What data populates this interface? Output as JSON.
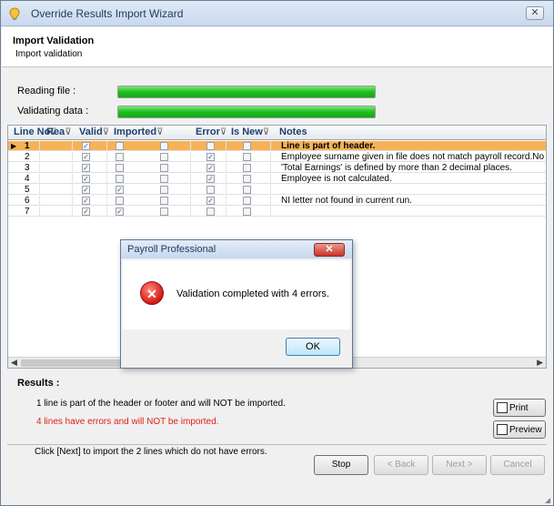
{
  "window": {
    "title": "Override Results Import Wizard",
    "close_label": "✕"
  },
  "header": {
    "title": "Import Validation",
    "subtitle": "Import validation"
  },
  "progress": [
    {
      "label": "Reading file :",
      "value": 1.0
    },
    {
      "label": "Validating data :",
      "value": 1.0
    }
  ],
  "grid": {
    "columns": [
      "Line No",
      "Rea",
      "Valid",
      "Imported",
      "Error",
      "Is New",
      "Notes"
    ],
    "filter_glyph": "⊽",
    "selected_marker": "▶",
    "rows": [
      {
        "line": "1",
        "read": true,
        "valid": false,
        "imported": false,
        "error": false,
        "is_new": false,
        "notes": "Line is part of header.",
        "selected": true
      },
      {
        "line": "2",
        "read": true,
        "valid": false,
        "imported": false,
        "error": true,
        "is_new": false,
        "notes": "Employee surname given in file does not match payroll record.No"
      },
      {
        "line": "3",
        "read": true,
        "valid": false,
        "imported": false,
        "error": true,
        "is_new": false,
        "notes": "'Total Earnings' is defined by more than 2 decimal places."
      },
      {
        "line": "4",
        "read": true,
        "valid": false,
        "imported": false,
        "error": true,
        "is_new": false,
        "notes": "Employee is not calculated."
      },
      {
        "line": "5",
        "read": true,
        "valid": true,
        "imported": false,
        "error": false,
        "is_new": false,
        "notes": ""
      },
      {
        "line": "6",
        "read": true,
        "valid": false,
        "imported": false,
        "error": true,
        "is_new": false,
        "notes": " NI letter not found in current run."
      },
      {
        "line": "7",
        "read": true,
        "valid": true,
        "imported": false,
        "error": false,
        "is_new": false,
        "notes": ""
      }
    ]
  },
  "results": {
    "label": "Results :",
    "line1": "1 line is part of the header or footer and will NOT be imported.",
    "line2": "4 lines have errors and will NOT be imported.",
    "line3": "Click [Next] to import the 2 lines which do not have errors."
  },
  "side_buttons": {
    "print": "Print",
    "preview": "Preview"
  },
  "nav_buttons": {
    "stop": "Stop",
    "back": "< Back",
    "next": "Next >",
    "cancel": "Cancel"
  },
  "dialog": {
    "title": "Payroll Professional",
    "close_label": "✕",
    "message": "Validation completed with 4 errors.",
    "icon_glyph": "✕",
    "ok_label": "OK"
  },
  "colors": {
    "selected_row": "#f7b257",
    "error_text": "#e0211a",
    "progress_fill": "#1fbf1f"
  }
}
